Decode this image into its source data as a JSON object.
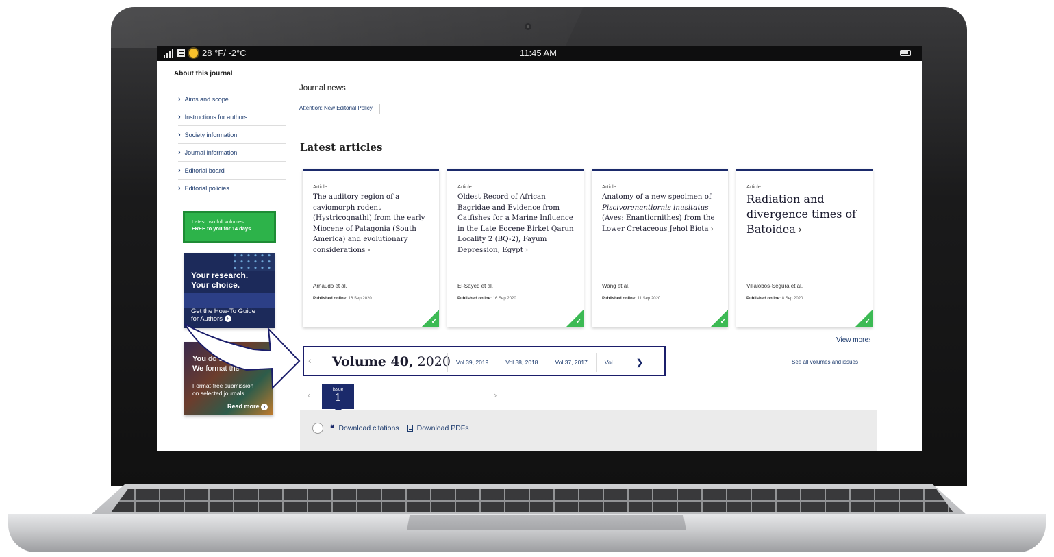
{
  "statusbar": {
    "weather": "28 °F/ -2°C",
    "time": "11:45 AM"
  },
  "sidebar": {
    "heading": "About this journal",
    "items": [
      {
        "label": "Aims and scope"
      },
      {
        "label": "Instructions for authors"
      },
      {
        "label": "Society information"
      },
      {
        "label": "Journal information"
      },
      {
        "label": "Editorial board"
      },
      {
        "label": "Editorial policies"
      }
    ],
    "promo_free": {
      "line1": "Latest two full volumes",
      "line2": "FREE to you for 14 days"
    },
    "promo_guide": {
      "line1": "Your research.",
      "line2": "Your choice.",
      "cta1": "Get the How-To Guide",
      "cta2": "for Authors"
    },
    "promo_format": {
      "line1a": "You",
      "line1b": " do th",
      "line2a": "We",
      "line2b": " format the",
      "body1": "Format-free submission",
      "body2": "on selected journals.",
      "read_more": "Read more"
    }
  },
  "news": {
    "heading": "Journal news",
    "link": "Attention: New Editorial Policy"
  },
  "latest": {
    "heading": "Latest articles",
    "cards": [
      {
        "kind": "Article",
        "title": "The auditory region of a caviomorph rodent (Hystricognathi) from the early Miocene of Patagonia (South America) and evolutionary considerations",
        "author": "Arnaudo et al.",
        "pub_label": "Published online:",
        "pub_date": "16 Sep 2020"
      },
      {
        "kind": "Article",
        "title": "Oldest Record of African Bagridae and Evidence from Catfishes for a Marine Influence in the Late Eocene Birket Qarun Locality 2 (BQ-2), Fayum Depression, Egypt",
        "author": "El-Sayed et al.",
        "pub_label": "Published online:",
        "pub_date": "16 Sep 2020"
      },
      {
        "kind": "Article",
        "title_a": "Anatomy of a new specimen of ",
        "title_em": "Piscivorenantiornis inusitatus",
        "title_b": " (Aves: Enantiornithes) from the Lower Cretaceous Jehol Biota",
        "author": "Wang et al.",
        "pub_label": "Published online:",
        "pub_date": "11 Sep 2020"
      },
      {
        "kind": "Article",
        "title": "Radiation and divergence times of Batoidea",
        "author": "Villalobos-Segura et al.",
        "pub_label": "Published online:",
        "pub_date": "8 Sep 2020"
      }
    ],
    "view_more": "View more"
  },
  "volumes": {
    "current_label": "Volume 40,",
    "current_year": "2020",
    "tabs": [
      "Vol 39, 2019",
      "Vol 38, 2018",
      "Vol 37, 2017",
      "Vol"
    ],
    "see_all": "See all volumes and issues"
  },
  "issue": {
    "label": "Issue",
    "number": "1"
  },
  "actions": {
    "download_citations": "Download citations",
    "download_pdfs": "Download PDFs"
  },
  "colors": {
    "brand_navy": "#1b2a6b",
    "open_access_green": "#3cba54",
    "promo_green": "#2db34a"
  }
}
